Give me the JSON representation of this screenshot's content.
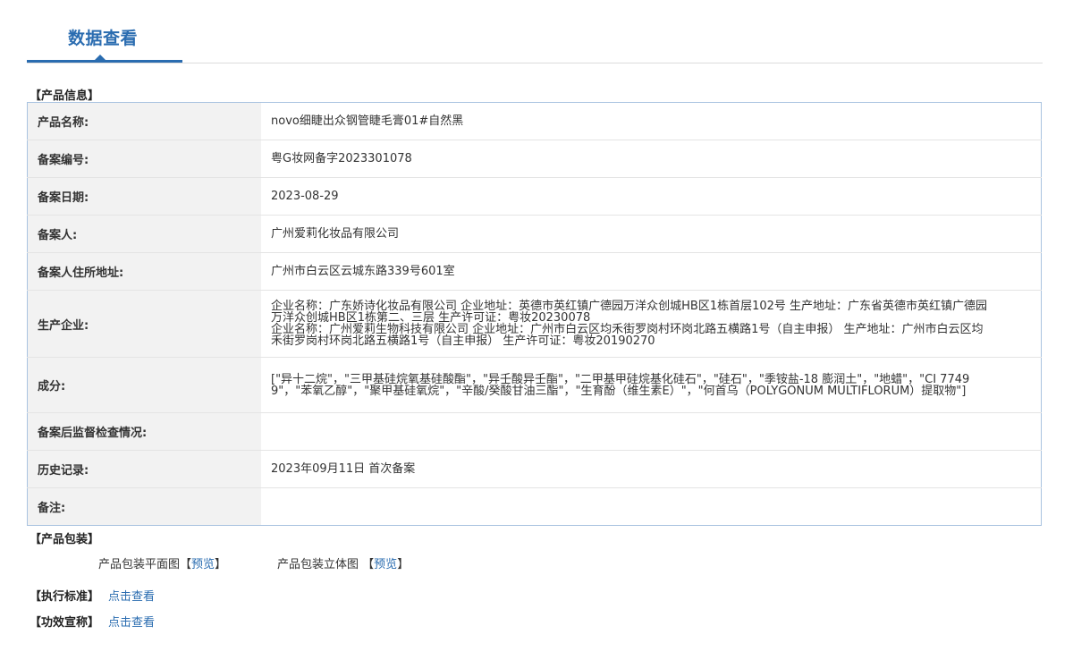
{
  "page": {
    "title": "数据查看"
  },
  "product_info": {
    "section_title": "【产品信息】",
    "rows": [
      {
        "label": "产品名称:",
        "value": "novo细睫出众钢管睫毛膏01#自然黑"
      },
      {
        "label": "备案编号:",
        "value": "粤G妆网备字2023301078"
      },
      {
        "label": "备案日期:",
        "value": "2023-08-29"
      },
      {
        "label": "备案人:",
        "value": "广州爱莉化妆品有限公司"
      },
      {
        "label": "备案人住所地址:",
        "value": "广州市白云区云城东路339号601室"
      },
      {
        "label": "生产企业:",
        "value": "企业名称：广东娇诗化妆品有限公司 企业地址：英德市英红镇广德园万洋众创城HB区1栋首层102号 生产地址：广东省英德市英红镇广德园万洋众创城HB区1栋第二、三层 生产许可证：粤妆20230078\n企业名称：广州爱莉生物科技有限公司 企业地址：广州市白云区均禾街罗岗村环岗北路五横路1号（自主申报） 生产地址：广州市白云区均禾街罗岗村环岗北路五横路1号（自主申报） 生产许可证：粤妆20190270"
      },
      {
        "label": "成分:",
        "value": "[\"异十二烷\"，\"三甲基硅烷氧基硅酸酯\"，\"异壬酸异壬酯\"，\"二甲基甲硅烷基化硅石\"，\"硅石\"，\"季铵盐-18 膨润土\"，\"地蜡\"，\"CI 77499\"，\"苯氧乙醇\"，\"聚甲基硅氧烷\"，\"辛酸/癸酸甘油三酯\"，\"生育酚（维生素E）\"，\"何首乌（POLYGONUM MULTIFLORUM）提取物\"]"
      },
      {
        "label": "备案后监督检查情况:",
        "value": ""
      },
      {
        "label": "历史记录:",
        "value": "2023年09月11日 首次备案"
      },
      {
        "label": "备注:",
        "value": ""
      }
    ]
  },
  "packaging": {
    "section_title": "【产品包装】",
    "flat_label": "产品包装平面图",
    "solid_label": "产品包装立体图",
    "bracket_open": "【",
    "bracket_close": "】",
    "preview_link": "预览"
  },
  "standard": {
    "label": "【执行标准】",
    "link": "点击查看"
  },
  "efficacy": {
    "label": "【功效宣称】",
    "link": "点击查看"
  }
}
